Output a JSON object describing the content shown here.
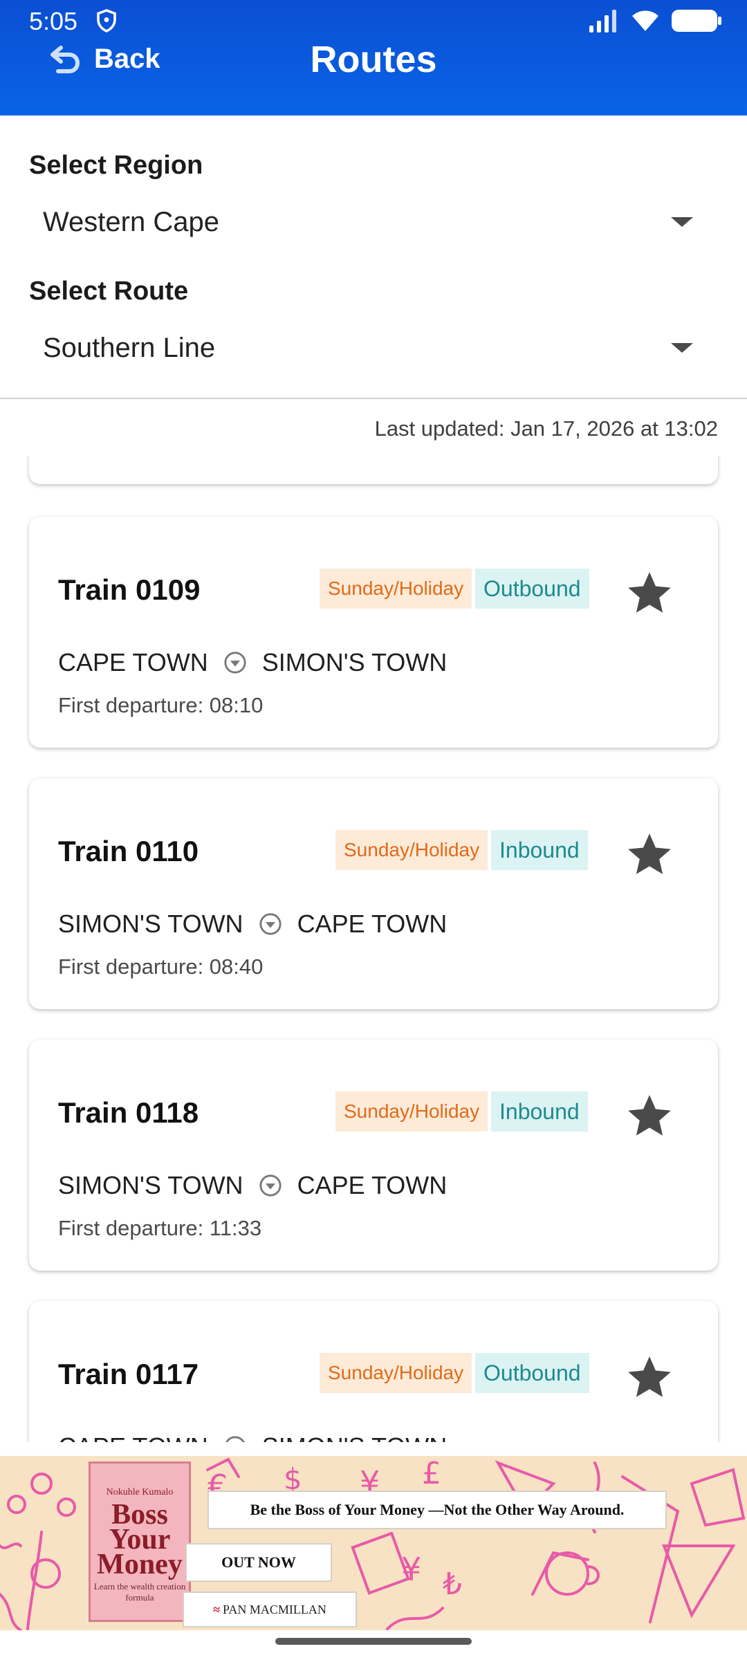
{
  "status": {
    "time": "5:05"
  },
  "header": {
    "back_label": "Back",
    "title": "Routes"
  },
  "region": {
    "label": "Select Region",
    "value": "Western Cape"
  },
  "route": {
    "label": "Select Route",
    "value": "Southern Line"
  },
  "last_updated": "Last updated: Jan 17, 2026 at 13:02",
  "trains": [
    {
      "name": "Train 0109",
      "day": "Sunday/Holiday",
      "direction": "Outbound",
      "from": "CAPE TOWN",
      "to": "SIMON'S TOWN",
      "first": "First departure: 08:10"
    },
    {
      "name": "Train 0110",
      "day": "Sunday/Holiday",
      "direction": "Inbound",
      "from": "SIMON'S TOWN",
      "to": "CAPE TOWN",
      "first": "First departure: 08:40"
    },
    {
      "name": "Train 0118",
      "day": "Sunday/Holiday",
      "direction": "Inbound",
      "from": "SIMON'S TOWN",
      "to": "CAPE TOWN",
      "first": "First departure: 11:33"
    },
    {
      "name": "Train 0117",
      "day": "Sunday/Holiday",
      "direction": "Outbound",
      "from": "CAPE TOWN",
      "to": "SIMON'S TOWN",
      "first": ""
    }
  ],
  "ad": {
    "book_author": "Nokuhle Kumalo",
    "book_title": "Boss Your Money",
    "book_subtitle": "Learn the wealth creation formula",
    "tagline": "Be the Boss of Your Money —Not the Other Way Around.",
    "cta": "OUT NOW",
    "publisher": "PAN MACMILLAN"
  },
  "colors": {
    "appbar": "#0a5bdf",
    "day_chip_bg": "#fdebd8",
    "day_chip_text": "#e16a1a",
    "dir_chip_bg": "#dcf3f3",
    "dir_chip_text": "#1d8a8e",
    "star": "#4a4a4a"
  },
  "icons": [
    "shield-icon",
    "signal-icon",
    "wifi-icon",
    "battery-icon",
    "back-arrow-icon",
    "dropdown-caret-icon",
    "star-icon",
    "route-arrow-icon"
  ]
}
